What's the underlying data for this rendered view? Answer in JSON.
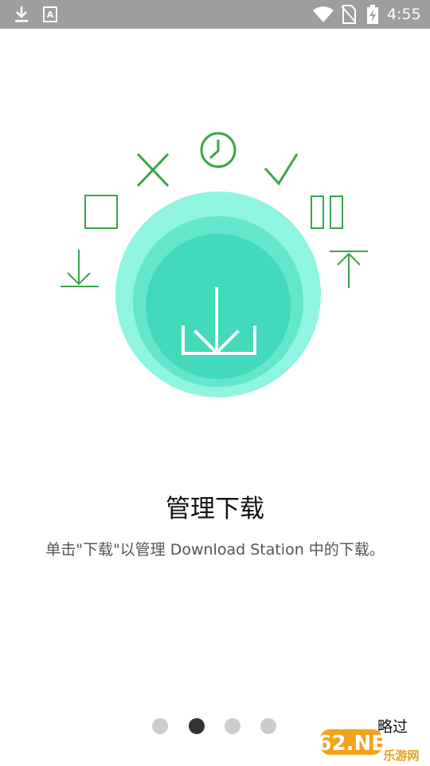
{
  "status_bar": {
    "time": "4:55",
    "icons": [
      "download-icon",
      "keyboard-a-icon",
      "wifi-icon",
      "no-sim-icon",
      "battery-charging-icon"
    ]
  },
  "onboarding": {
    "illustration_icons": [
      "download-arrow-icon",
      "square-icon",
      "close-x-icon",
      "clock-icon",
      "checkmark-icon",
      "pause-icon",
      "upload-arrow-icon",
      "download-tray-icon"
    ],
    "title": "管理下载",
    "description": "单击\"下载\"以管理 Download Station 中的下载。",
    "pagination": {
      "total": 4,
      "current": 2
    },
    "skip_label": "略过"
  },
  "watermark": {
    "brand": "962.NET",
    "sub": "乐游网"
  },
  "colors": {
    "status_bar_bg": "#9e9e9e",
    "icon_green": "#3aa54a",
    "circle_outer": "#8ff5e0",
    "circle_middle": "#64e6cc",
    "circle_inner": "#43d9bb",
    "dot_inactive": "#cccccc",
    "dot_active": "#333333"
  }
}
